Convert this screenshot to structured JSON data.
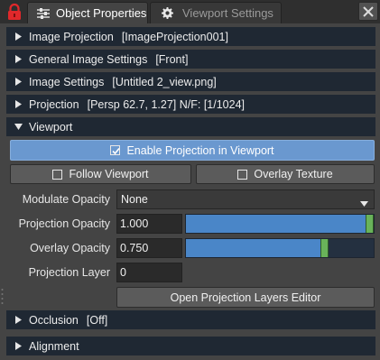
{
  "tabs": {
    "active_label": "Object Properties",
    "inactive_label": "Viewport Settings",
    "active_icon": "sliders-icon",
    "inactive_icon": "gear-icon",
    "lock_color": "#e0282b"
  },
  "sections": [
    {
      "label": "Image Projection",
      "value": "[ImageProjection001]",
      "expanded": false
    },
    {
      "label": "General Image Settings",
      "value": "[Front]",
      "expanded": false
    },
    {
      "label": "Image Settings",
      "value": "[Untitled 2_view.png]",
      "expanded": false
    },
    {
      "label": "Projection",
      "value": "[Persp 62.7, 1.27] N/F: [1/1024]",
      "expanded": false
    },
    {
      "label": "Viewport",
      "value": "",
      "expanded": true
    },
    {
      "label": "Occlusion",
      "value": "[Off]",
      "expanded": false
    },
    {
      "label": "Alignment",
      "value": "",
      "expanded": false
    }
  ],
  "viewport": {
    "enable_projection": {
      "label": "Enable Projection in Viewport",
      "checked": true
    },
    "follow_viewport": {
      "label": "Follow Viewport",
      "checked": false
    },
    "overlay_texture": {
      "label": "Overlay Texture",
      "checked": false
    },
    "modulate_opacity": {
      "label": "Modulate Opacity",
      "value": "None"
    },
    "projection_opacity": {
      "label": "Projection Opacity",
      "value": "1.000",
      "fraction": 1.0
    },
    "overlay_opacity": {
      "label": "Overlay Opacity",
      "value": "0.750",
      "fraction": 0.75
    },
    "projection_layer": {
      "label": "Projection Layer",
      "value": "0"
    },
    "open_layers_editor": {
      "label": "Open Projection Layers Editor"
    }
  },
  "colors": {
    "accent": "#6a98cf",
    "slider_fill": "#4a86c8",
    "slider_handle": "#69b35a",
    "section_bg": "#1f2833"
  }
}
